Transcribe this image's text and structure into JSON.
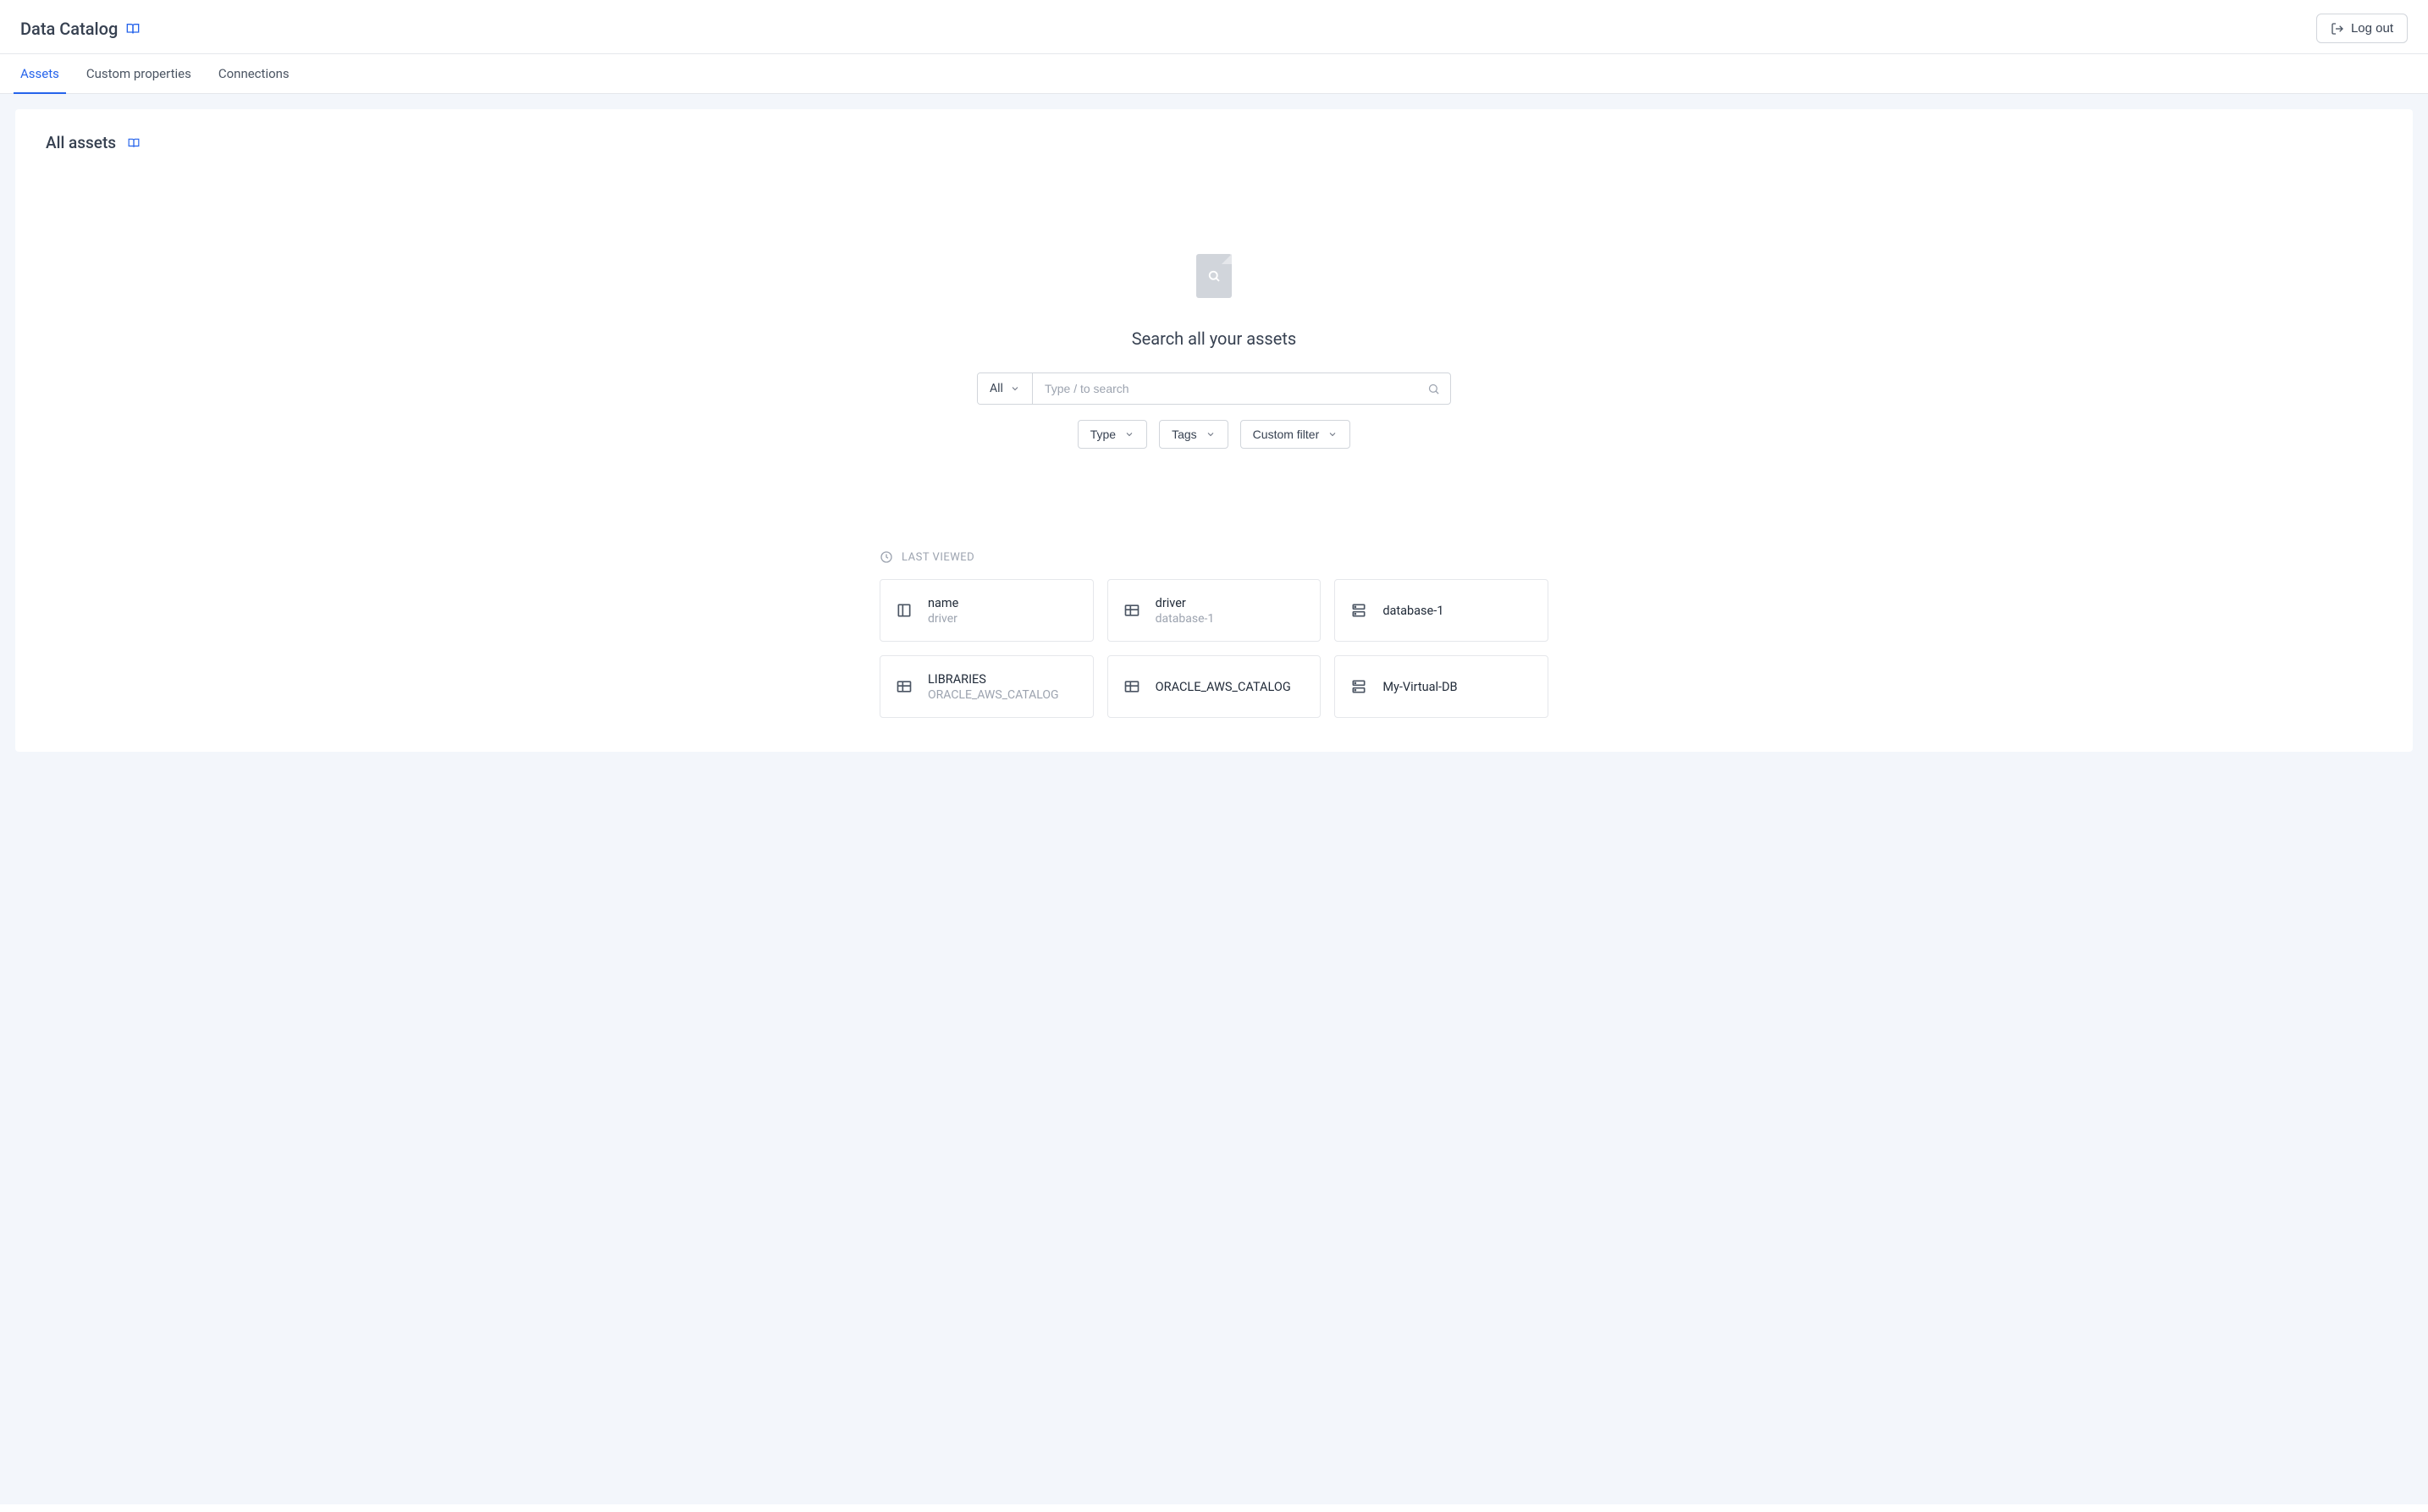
{
  "header": {
    "title": "Data Catalog",
    "logout_label": "Log out"
  },
  "tabs": [
    {
      "label": "Assets",
      "active": true
    },
    {
      "label": "Custom properties",
      "active": false
    },
    {
      "label": "Connections",
      "active": false
    }
  ],
  "panel": {
    "title": "All assets"
  },
  "search": {
    "hero_title": "Search all your assets",
    "scope_label": "All",
    "placeholder": "Type / to search"
  },
  "filters": [
    {
      "label": "Type"
    },
    {
      "label": "Tags"
    },
    {
      "label": "Custom filter"
    }
  ],
  "last_viewed": {
    "heading": "LAST VIEWED",
    "items": [
      {
        "title": "name",
        "subtitle": "driver",
        "icon": "column"
      },
      {
        "title": "driver",
        "subtitle": "database-1",
        "icon": "table"
      },
      {
        "title": "database-1",
        "subtitle": "",
        "icon": "database"
      },
      {
        "title": "LIBRARIES",
        "subtitle": "ORACLE_AWS_CATALOG",
        "icon": "table"
      },
      {
        "title": "ORACLE_AWS_CATALOG",
        "subtitle": "",
        "icon": "table"
      },
      {
        "title": "My-Virtual-DB",
        "subtitle": "",
        "icon": "database"
      }
    ]
  }
}
